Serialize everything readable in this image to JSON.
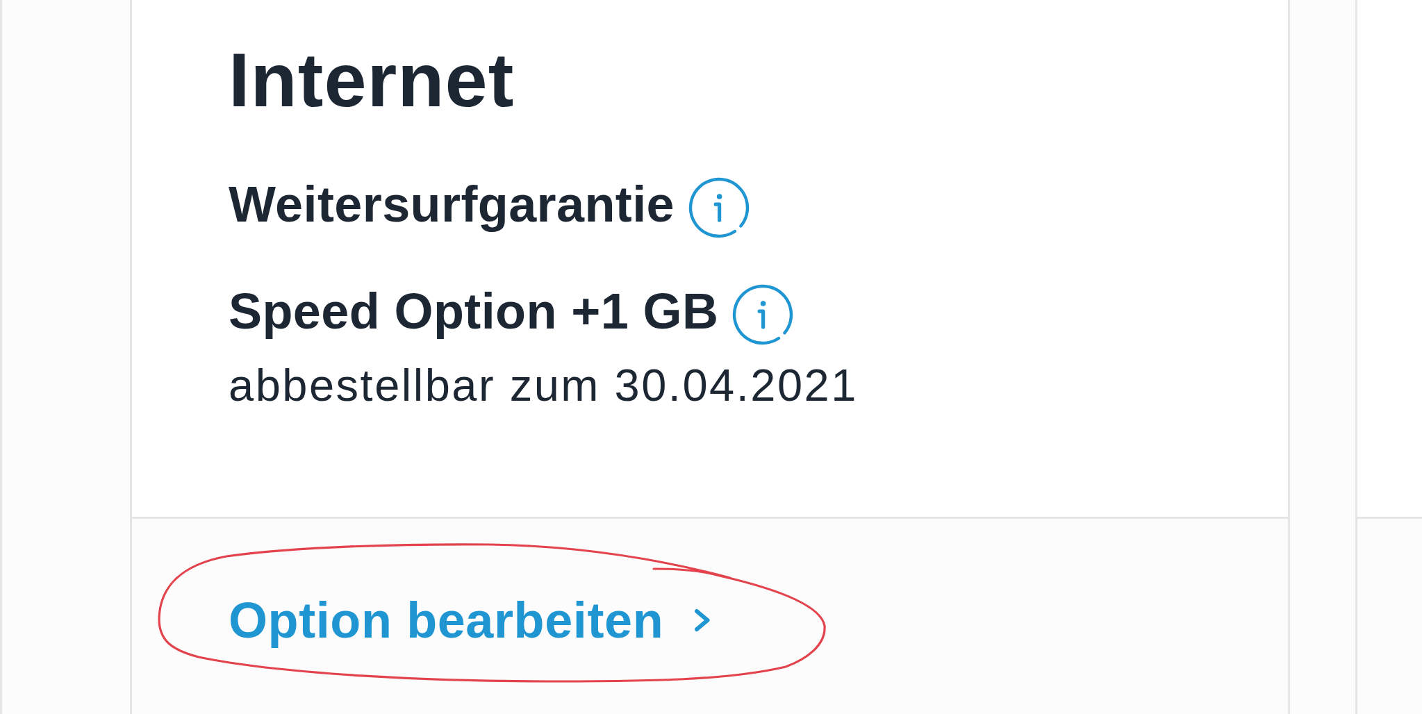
{
  "card": {
    "title": "Internet",
    "options": [
      {
        "name": "Weitersurfgarantie",
        "info": true
      },
      {
        "name": "Speed Option +1 GB",
        "info": true,
        "note": "abbestellbar zum 30.04.2021"
      }
    ],
    "action": {
      "label": "Option bearbeiten",
      "circled": true
    }
  }
}
